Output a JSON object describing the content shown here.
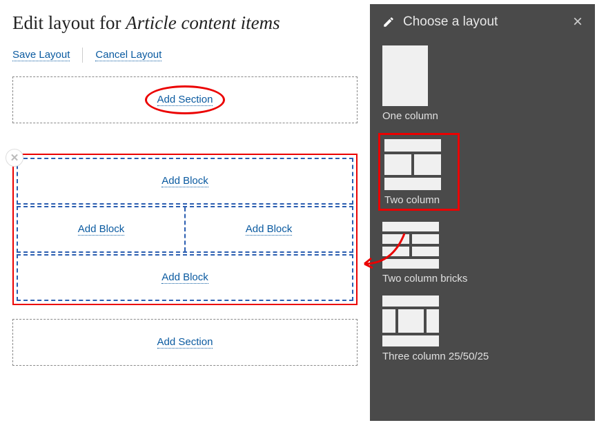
{
  "header": {
    "title_prefix": "Edit layout for ",
    "title_em": "Article content items"
  },
  "actions": {
    "save": "Save Layout",
    "cancel": "Cancel Layout"
  },
  "main": {
    "add_section": "Add Section",
    "add_block": "Add Block"
  },
  "sidebar": {
    "title": "Choose a layout",
    "options": [
      {
        "label": "One column"
      },
      {
        "label": "Two column"
      },
      {
        "label": "Two column bricks"
      },
      {
        "label": "Three column 25/50/25"
      }
    ]
  }
}
